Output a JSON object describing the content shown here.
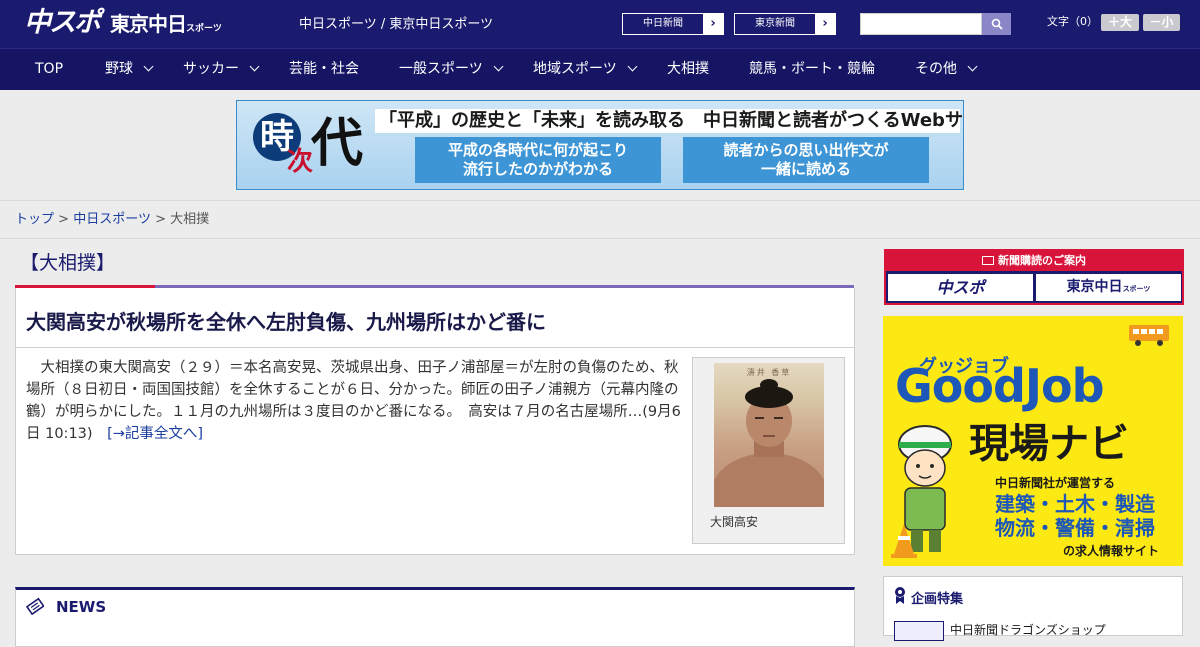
{
  "header": {
    "logo_main": "中スポ",
    "logo_tokyo": "東京中日",
    "logo_tokyo_small": "スポーツ",
    "site_link": "中日スポーツ / 東京中日スポーツ",
    "paper_buttons": [
      "中日新聞",
      "東京新聞"
    ],
    "search_placeholder": "",
    "fontsize_label": "文字（0）",
    "font_larger": "＋大",
    "font_smaller": "－小",
    "colors": {
      "header_bg": "#1a1a6e",
      "nav_bg": "#151564",
      "accent_red": "#d8143a"
    }
  },
  "nav": {
    "items": [
      {
        "label": "TOP",
        "dropdown": false
      },
      {
        "label": "野球",
        "dropdown": true
      },
      {
        "label": "サッカー",
        "dropdown": true
      },
      {
        "label": "芸能・社会",
        "dropdown": false
      },
      {
        "label": "一般スポーツ",
        "dropdown": true
      },
      {
        "label": "地域スポーツ",
        "dropdown": true
      },
      {
        "label": "大相撲",
        "dropdown": false
      },
      {
        "label": "競馬・ボート・競輪",
        "dropdown": false
      },
      {
        "label": "その他",
        "dropdown": true
      }
    ]
  },
  "banner": {
    "kanji_1": "時",
    "kanji_2": "次",
    "kanji_3": "代",
    "headline": "「平成」の歴史と「未来」を読み取る　中日新聞と読者がつくるWebサイト",
    "box_left_line1": "平成の各時代に何が起こり",
    "box_left_line2": "流行したのかがわかる",
    "box_right_line1": "読者からの思い出作文が",
    "box_right_line2": "一緒に読める"
  },
  "breadcrumb": {
    "top": "トップ",
    "section": "中日スポーツ",
    "current": "大相撲",
    "sep": ">"
  },
  "category": {
    "title": "【大相撲】"
  },
  "article": {
    "headline": "大関高安が秋場所を全休へ左肘負傷、九州場所はかど番に",
    "body": "　大相撲の東大関高安（２９）＝本名高安晃、茨城県出身、田子ノ浦部屋＝が左肘の負傷のため、秋場所（８日初日・両国国技館）を全休することが６日、分かった。師匠の田子ノ浦親方（元幕内隆の鶴）が明らかにした。１１月の九州場所は３度目のかど番になる。　高安は７月の名古屋場所…(9月6日 10:13)",
    "more_link": "[→記事全文へ]",
    "photo_caption": "大関高安",
    "photo_plaque": "濤井 香草"
  },
  "news": {
    "title": "NEWS"
  },
  "sidebar": {
    "subscribe_title": "新聞購読のご案内",
    "subscribe_left": "中スポ",
    "subscribe_right": "東京中日",
    "subscribe_right_small": "スポーツ",
    "goodjob_sub": "グッジョブ",
    "goodjob_main": "GoodJob",
    "goodjob_navi": "現場ナビ",
    "goodjob_line": "中日新聞社が運営する",
    "goodjob_big1": "建築・土木・製造",
    "goodjob_big2": "物流・警備・清掃",
    "goodjob_foot": "の求人情報サイト",
    "feature_title": "企画特集",
    "feature_item": "中日新聞ドラゴンズショップ"
  }
}
